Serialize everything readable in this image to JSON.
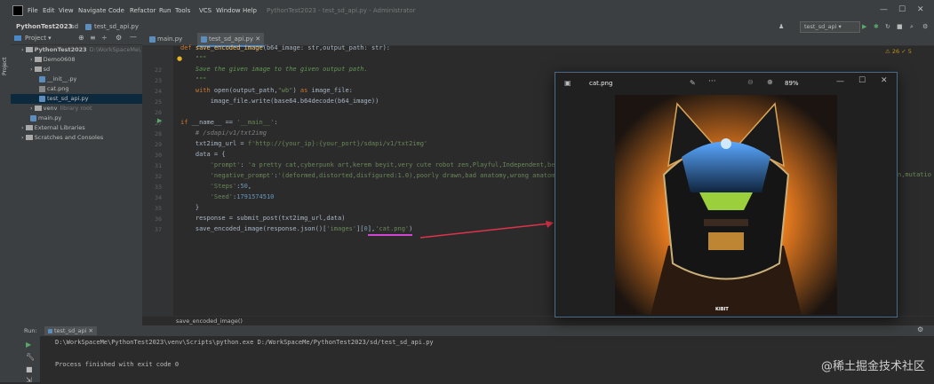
{
  "menu": {
    "items": [
      "File",
      "Edit",
      "View",
      "Navigate",
      "Code",
      "Refactor",
      "Run",
      "Tools",
      "VCS",
      "Window",
      "Help"
    ],
    "window_title": "PythonTest2023 - test_sd_api.py - Administrator"
  },
  "navbar": {
    "crumbs": [
      "PythonTest2023",
      "sd",
      "test_sd_api.py"
    ],
    "run_config": "test_sd_api"
  },
  "editor_tabs": [
    {
      "label": "main.py",
      "active": false
    },
    {
      "label": "test_sd_api.py",
      "active": true
    }
  ],
  "project_panel": {
    "header": "Project",
    "tree": [
      {
        "label": "PythonTest2023",
        "suffix": "D:\\WorkSpaceMe\\",
        "type": "folder",
        "indent": 0
      },
      {
        "label": "Demo0608",
        "type": "folder",
        "indent": 1
      },
      {
        "label": "sd",
        "type": "folder",
        "indent": 1
      },
      {
        "label": "__init__.py",
        "type": "py",
        "indent": 2
      },
      {
        "label": "cat.png",
        "type": "png",
        "indent": 2
      },
      {
        "label": "test_sd_api.py",
        "type": "py",
        "indent": 2,
        "selected": true
      },
      {
        "label": "venv",
        "suffix": "library root",
        "type": "folder",
        "indent": 1
      },
      {
        "label": "main.py",
        "type": "py",
        "indent": 1
      },
      {
        "label": "External Libraries",
        "type": "lib",
        "indent": 0
      },
      {
        "label": "Scratches and Consoles",
        "type": "lib",
        "indent": 0
      }
    ]
  },
  "editor": {
    "inspection": "⚠ 26 ✓ 5",
    "lines": [
      {
        "n": "",
        "html": "<span class='kw'>def</span> <span class='fn'>save_encoded_image</span>(b64_image: str,output_path: str):"
      },
      {
        "n": "",
        "html": "    <span class='doc'>\"\"\"</span>"
      },
      {
        "n": "22",
        "html": "    <span class='doc'>Save the given image to the given output path.</span>"
      },
      {
        "n": "",
        "html": "    <span class='doc'>\"\"\"</span>"
      },
      {
        "n": "",
        "html": "    <span class='kw'>with</span> open(output_path,<span class='str'>\"wb\"</span>) <span class='kw'>as</span> image_file:"
      },
      {
        "n": "",
        "html": "        image_file.write(base64.b64decode(b64_image))"
      },
      {
        "n": "",
        "html": ""
      },
      {
        "n": "27",
        "html": "<span class='kw'>if</span> __name__ == <span class='str'>'__main__'</span>:"
      },
      {
        "n": "",
        "html": "    <span class='cm'># /sdapi/v1/txt2img</span>"
      },
      {
        "n": "",
        "html": "    txt2img_url = <span class='str'>f'http://{your_ip}:{your_port}/sdapi/v1/txt2img'</span>"
      },
      {
        "n": "",
        "html": "    data = {"
      },
      {
        "n": "",
        "html": "        <span class='str'>'prompt'</span>: <span class='str'>'a pretty cat,cyberpunk art,kerem beyit,very cute robot zen,Playful,Independent,beyp</span>"
      },
      {
        "n": "",
        "html": "        <span class='str'>'negative_prompt'</span>:<span class='str'>'(deformed,distorted,disfigured:1.0),poorly drawn,bad anatomy,wrong anatomy</span>"
      },
      {
        "n": "",
        "html": "        <span class='str'>'Steps'</span>:<span class='num'>50</span>,"
      },
      {
        "n": "",
        "html": "        <span class='str'>'Seed'</span>:<span class='num'>1791574510</span>"
      },
      {
        "n": "",
        "html": "    }"
      },
      {
        "n": "",
        "html": "    response = submit_post(txt2img_url,data)"
      },
      {
        "n": "",
        "html": "    save_encoded_image(response.json()[<span class='str'>'images'</span>][<span class='num'>0</span>],<span class='str'>'cat.png'</span>)"
      }
    ],
    "line_numbers": [
      "",
      "",
      "22",
      "23",
      "24",
      "25",
      "26",
      "27",
      "28",
      "29",
      "30",
      "31",
      "32",
      "33",
      "34",
      "35",
      "36",
      "37"
    ],
    "overflow_right": "n,mutatio"
  },
  "breadcrumb": "save_encoded_image()",
  "run": {
    "tab_label": "Run:",
    "config": "test_sd_api",
    "lines": [
      "D:\\WorkSpaceMe\\PythonTest2023\\venv\\Scripts\\python.exe D:/WorkSpaceMe/PythonTest2023/sd/test_sd_api.py",
      "",
      "Process finished with exit code 0"
    ]
  },
  "viewer": {
    "filename": "cat.png",
    "zoom": "89%",
    "caption": "KIBIT"
  },
  "watermark": "@稀土掘金技术社区",
  "colors": {
    "accent": "#4a88c7",
    "annotation": "#e0334a",
    "underline": "#d246d2"
  }
}
